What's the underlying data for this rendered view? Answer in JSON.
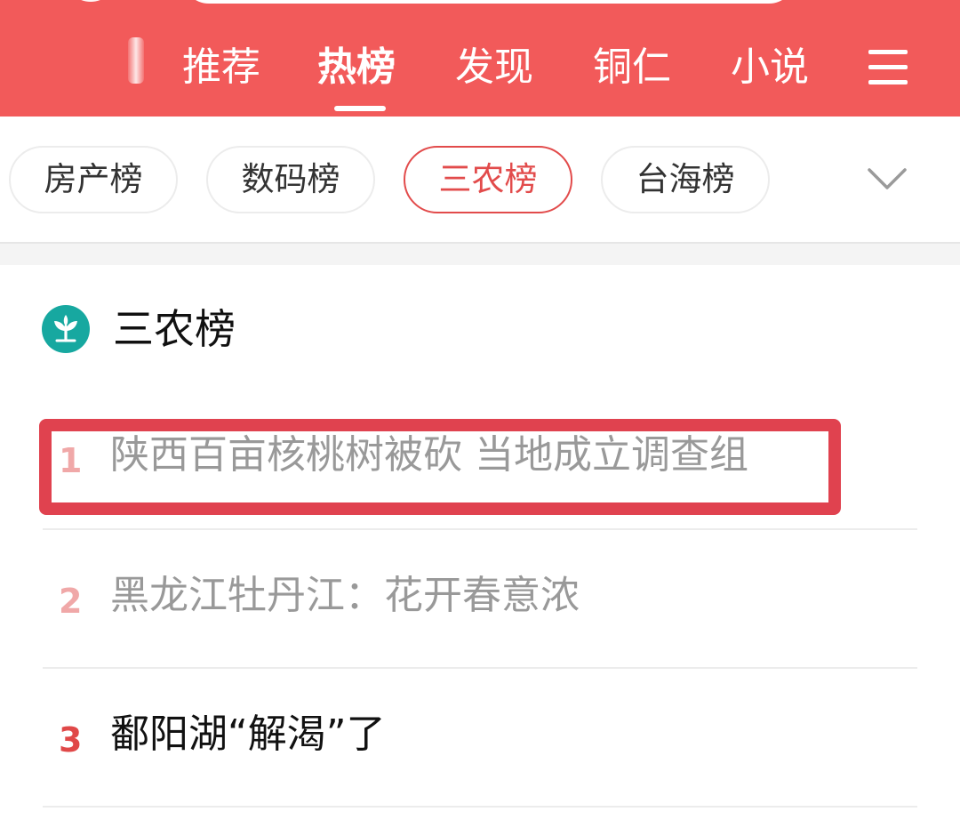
{
  "top_nav": {
    "tabs": [
      {
        "label": "推荐",
        "active": false
      },
      {
        "label": "热榜",
        "active": true
      },
      {
        "label": "发现",
        "active": false
      },
      {
        "label": "铜仁",
        "active": false
      },
      {
        "label": "小说",
        "active": false
      }
    ],
    "menu_icon": "menu-icon",
    "background_color": "#f25a5a"
  },
  "chips": {
    "items": [
      {
        "label": "房产榜",
        "active": false
      },
      {
        "label": "数码榜",
        "active": false
      },
      {
        "label": "三农榜",
        "active": true
      },
      {
        "label": "台海榜",
        "active": false
      }
    ],
    "expand_icon": "chevron-down-icon",
    "active_color": "#e24b4b"
  },
  "section": {
    "icon": "sprout-icon",
    "icon_color": "#17a8a0",
    "title": "三农榜",
    "items": [
      {
        "rank": "1",
        "title": "陕西百亩核桃树被砍 当地成立调查组",
        "rank_color": "#f0a8a8",
        "text_color": "#999999",
        "highlighted": true
      },
      {
        "rank": "2",
        "title": "黑龙江牡丹江：花开春意浓",
        "rank_color": "#f0a8a8",
        "text_color": "#999999",
        "highlighted": false
      },
      {
        "rank": "3",
        "title": "鄱阳湖“解渴”了",
        "rank_color": "#e04848",
        "text_color": "#111111",
        "highlighted": false
      }
    ]
  },
  "highlight_color": "#e0424f"
}
